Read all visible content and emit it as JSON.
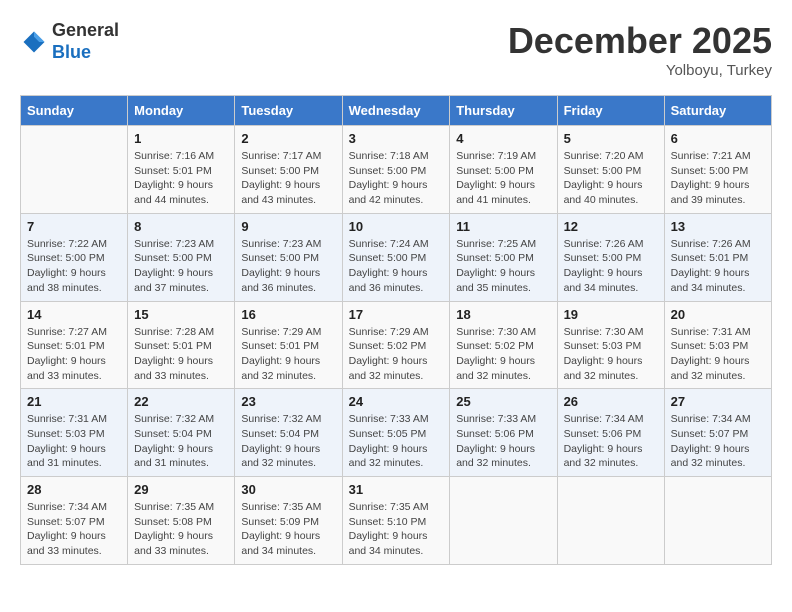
{
  "header": {
    "logo_general": "General",
    "logo_blue": "Blue",
    "month_title": "December 2025",
    "location": "Yolboyu, Turkey"
  },
  "columns": [
    "Sunday",
    "Monday",
    "Tuesday",
    "Wednesday",
    "Thursday",
    "Friday",
    "Saturday"
  ],
  "weeks": [
    [
      {
        "day": "",
        "sunrise": "",
        "sunset": "",
        "daylight": ""
      },
      {
        "day": "1",
        "sunrise": "Sunrise: 7:16 AM",
        "sunset": "Sunset: 5:01 PM",
        "daylight": "Daylight: 9 hours and 44 minutes."
      },
      {
        "day": "2",
        "sunrise": "Sunrise: 7:17 AM",
        "sunset": "Sunset: 5:00 PM",
        "daylight": "Daylight: 9 hours and 43 minutes."
      },
      {
        "day": "3",
        "sunrise": "Sunrise: 7:18 AM",
        "sunset": "Sunset: 5:00 PM",
        "daylight": "Daylight: 9 hours and 42 minutes."
      },
      {
        "day": "4",
        "sunrise": "Sunrise: 7:19 AM",
        "sunset": "Sunset: 5:00 PM",
        "daylight": "Daylight: 9 hours and 41 minutes."
      },
      {
        "day": "5",
        "sunrise": "Sunrise: 7:20 AM",
        "sunset": "Sunset: 5:00 PM",
        "daylight": "Daylight: 9 hours and 40 minutes."
      },
      {
        "day": "6",
        "sunrise": "Sunrise: 7:21 AM",
        "sunset": "Sunset: 5:00 PM",
        "daylight": "Daylight: 9 hours and 39 minutes."
      }
    ],
    [
      {
        "day": "7",
        "sunrise": "Sunrise: 7:22 AM",
        "sunset": "Sunset: 5:00 PM",
        "daylight": "Daylight: 9 hours and 38 minutes."
      },
      {
        "day": "8",
        "sunrise": "Sunrise: 7:23 AM",
        "sunset": "Sunset: 5:00 PM",
        "daylight": "Daylight: 9 hours and 37 minutes."
      },
      {
        "day": "9",
        "sunrise": "Sunrise: 7:23 AM",
        "sunset": "Sunset: 5:00 PM",
        "daylight": "Daylight: 9 hours and 36 minutes."
      },
      {
        "day": "10",
        "sunrise": "Sunrise: 7:24 AM",
        "sunset": "Sunset: 5:00 PM",
        "daylight": "Daylight: 9 hours and 36 minutes."
      },
      {
        "day": "11",
        "sunrise": "Sunrise: 7:25 AM",
        "sunset": "Sunset: 5:00 PM",
        "daylight": "Daylight: 9 hours and 35 minutes."
      },
      {
        "day": "12",
        "sunrise": "Sunrise: 7:26 AM",
        "sunset": "Sunset: 5:00 PM",
        "daylight": "Daylight: 9 hours and 34 minutes."
      },
      {
        "day": "13",
        "sunrise": "Sunrise: 7:26 AM",
        "sunset": "Sunset: 5:01 PM",
        "daylight": "Daylight: 9 hours and 34 minutes."
      }
    ],
    [
      {
        "day": "14",
        "sunrise": "Sunrise: 7:27 AM",
        "sunset": "Sunset: 5:01 PM",
        "daylight": "Daylight: 9 hours and 33 minutes."
      },
      {
        "day": "15",
        "sunrise": "Sunrise: 7:28 AM",
        "sunset": "Sunset: 5:01 PM",
        "daylight": "Daylight: 9 hours and 33 minutes."
      },
      {
        "day": "16",
        "sunrise": "Sunrise: 7:29 AM",
        "sunset": "Sunset: 5:01 PM",
        "daylight": "Daylight: 9 hours and 32 minutes."
      },
      {
        "day": "17",
        "sunrise": "Sunrise: 7:29 AM",
        "sunset": "Sunset: 5:02 PM",
        "daylight": "Daylight: 9 hours and 32 minutes."
      },
      {
        "day": "18",
        "sunrise": "Sunrise: 7:30 AM",
        "sunset": "Sunset: 5:02 PM",
        "daylight": "Daylight: 9 hours and 32 minutes."
      },
      {
        "day": "19",
        "sunrise": "Sunrise: 7:30 AM",
        "sunset": "Sunset: 5:03 PM",
        "daylight": "Daylight: 9 hours and 32 minutes."
      },
      {
        "day": "20",
        "sunrise": "Sunrise: 7:31 AM",
        "sunset": "Sunset: 5:03 PM",
        "daylight": "Daylight: 9 hours and 32 minutes."
      }
    ],
    [
      {
        "day": "21",
        "sunrise": "Sunrise: 7:31 AM",
        "sunset": "Sunset: 5:03 PM",
        "daylight": "Daylight: 9 hours and 31 minutes."
      },
      {
        "day": "22",
        "sunrise": "Sunrise: 7:32 AM",
        "sunset": "Sunset: 5:04 PM",
        "daylight": "Daylight: 9 hours and 31 minutes."
      },
      {
        "day": "23",
        "sunrise": "Sunrise: 7:32 AM",
        "sunset": "Sunset: 5:04 PM",
        "daylight": "Daylight: 9 hours and 32 minutes."
      },
      {
        "day": "24",
        "sunrise": "Sunrise: 7:33 AM",
        "sunset": "Sunset: 5:05 PM",
        "daylight": "Daylight: 9 hours and 32 minutes."
      },
      {
        "day": "25",
        "sunrise": "Sunrise: 7:33 AM",
        "sunset": "Sunset: 5:06 PM",
        "daylight": "Daylight: 9 hours and 32 minutes."
      },
      {
        "day": "26",
        "sunrise": "Sunrise: 7:34 AM",
        "sunset": "Sunset: 5:06 PM",
        "daylight": "Daylight: 9 hours and 32 minutes."
      },
      {
        "day": "27",
        "sunrise": "Sunrise: 7:34 AM",
        "sunset": "Sunset: 5:07 PM",
        "daylight": "Daylight: 9 hours and 32 minutes."
      }
    ],
    [
      {
        "day": "28",
        "sunrise": "Sunrise: 7:34 AM",
        "sunset": "Sunset: 5:07 PM",
        "daylight": "Daylight: 9 hours and 33 minutes."
      },
      {
        "day": "29",
        "sunrise": "Sunrise: 7:35 AM",
        "sunset": "Sunset: 5:08 PM",
        "daylight": "Daylight: 9 hours and 33 minutes."
      },
      {
        "day": "30",
        "sunrise": "Sunrise: 7:35 AM",
        "sunset": "Sunset: 5:09 PM",
        "daylight": "Daylight: 9 hours and 34 minutes."
      },
      {
        "day": "31",
        "sunrise": "Sunrise: 7:35 AM",
        "sunset": "Sunset: 5:10 PM",
        "daylight": "Daylight: 9 hours and 34 minutes."
      },
      {
        "day": "",
        "sunrise": "",
        "sunset": "",
        "daylight": ""
      },
      {
        "day": "",
        "sunrise": "",
        "sunset": "",
        "daylight": ""
      },
      {
        "day": "",
        "sunrise": "",
        "sunset": "",
        "daylight": ""
      }
    ]
  ]
}
